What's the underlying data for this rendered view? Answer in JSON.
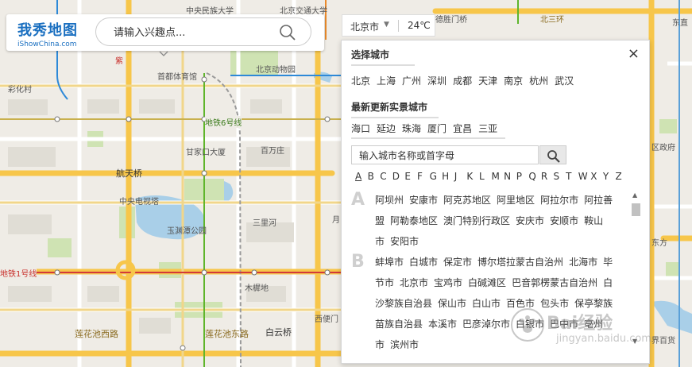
{
  "logo": {
    "main": "我秀地图",
    "sub": "iShowChina.com"
  },
  "search": {
    "placeholder": "请输入兴趣点..."
  },
  "city_selector": {
    "city": "北京市",
    "temperature": "24℃"
  },
  "panel": {
    "select_city_title": "选择城市",
    "close_label": "×",
    "hot_cities": [
      "北京",
      "上海",
      "广州",
      "深圳",
      "成都",
      "天津",
      "南京",
      "杭州",
      "武汉"
    ],
    "latest_title": "最新更新实景城市",
    "latest_cities": [
      "海口",
      "延边",
      "珠海",
      "厦门",
      "宜昌",
      "三亚"
    ],
    "search_placeholder": "输入城市名称或首字母",
    "letters": [
      "A",
      "B",
      "C",
      "D",
      "E",
      "F",
      "G",
      "H",
      "J",
      "K",
      "L",
      "M",
      "N",
      "P",
      "Q",
      "R",
      "S",
      "T",
      "W",
      "X",
      "Y",
      "Z"
    ],
    "active_letter": "A",
    "groups": [
      {
        "letter": "A",
        "lines": [
          [
            "阿坝州",
            "安康市",
            "阿克苏地区",
            "阿里地区",
            "阿拉尔市",
            "阿拉善"
          ],
          [
            "盟",
            "阿勒泰地区",
            "澳门特别行政区",
            "安庆市",
            "安顺市",
            "鞍山"
          ],
          [
            "市",
            "安阳市"
          ]
        ]
      },
      {
        "letter": "B",
        "lines": [
          [
            "蚌埠市",
            "白城市",
            "保定市",
            "博尔塔拉蒙古自治州",
            "北海市",
            "毕"
          ],
          [
            "节市",
            "北京市",
            "宝鸡市",
            "白碱滩区",
            "巴音郭楞蒙古自治州",
            "白"
          ],
          [
            "沙黎族自治县",
            "保山市",
            "白山市",
            "百色市",
            "包头市",
            "保亭黎族"
          ],
          [
            "苗族自治县",
            "本溪市",
            "巴彦淖尔市",
            "白银市",
            "巴中市",
            "亳州"
          ],
          [
            "市",
            "滨州市"
          ]
        ]
      }
    ]
  },
  "watermark": {
    "main": "Bai经验",
    "sub": "jingyan.baidu.com"
  },
  "map_labels": {
    "minzu_univ": "中央民族大学",
    "jiaotong_univ": "北京交通大学",
    "deshengmen": "德胜门桥",
    "beisanhuan": "北三环",
    "dongzhi": "东直",
    "tsinghua_purple": "紫",
    "shoudu_gym": "首都体育馆",
    "zoo": "北京动物园",
    "caihecun": "彩化村",
    "line6": "地铁6号线",
    "ganjiakou": "甘家口大厦",
    "baiwanzhuang": "百万庄",
    "hangtianqiao": "航天桥",
    "cctv": "中央电视塔",
    "yuyuantan": "玉渊潭公园",
    "sanlihe": "三里河",
    "yue": "月",
    "line1": "地铁1号线",
    "muxidi": "木樨地",
    "xibianmen": "西便门",
    "lianhuachi_w": "莲花池西路",
    "lianhuachi_e": "莲花池东路",
    "baiyunqiao": "白云桥",
    "quzhengfu": "区政府",
    "huanhudong": "东方",
    "xidan": "西",
    "jie": "界百货"
  },
  "colors": {
    "accent": "#1a6fc0",
    "subway_green": "#5fb52b",
    "road_yellow": "#f7c64a",
    "water": "#a9cfe8",
    "park": "#cfe3b3"
  }
}
